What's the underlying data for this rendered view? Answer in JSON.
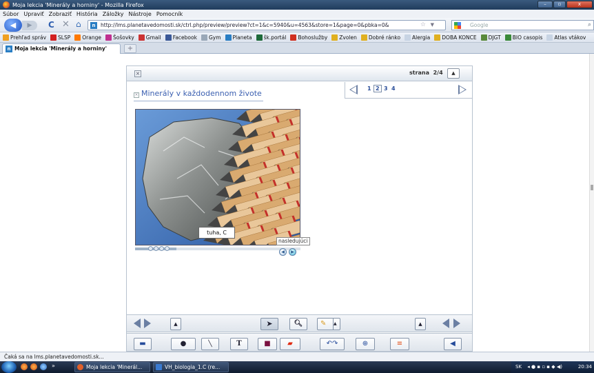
{
  "window": {
    "title": "Moja lekcia 'Minerály a horniny' - Mozilla Firefox",
    "controls": [
      "–",
      "▫",
      "x"
    ]
  },
  "menu": [
    "Súbor",
    "Upraviť",
    "Zobraziť",
    "História",
    "Záložky",
    "Nástroje",
    "Pomocník"
  ],
  "navbar": {
    "url": "http://lms.planetavedomosti.sk/ctrl.php/preview/preview?ct=1&c=5940&u=4563&store=1&page=0&pbka=0&",
    "search_placeholder": "Google"
  },
  "bookmarks": [
    {
      "label": "Prehľad správ",
      "color": "#f0a020"
    },
    {
      "label": "SLSP",
      "color": "#d22020"
    },
    {
      "label": "Orange",
      "color": "#ff7900"
    },
    {
      "label": "Šošovky",
      "color": "#c03090"
    },
    {
      "label": "Gmail",
      "color": "#c33"
    },
    {
      "label": "Facebook",
      "color": "#3b5998"
    },
    {
      "label": "Gym",
      "color": "#9aa8b8"
    },
    {
      "label": "Planeta",
      "color": "#2a7ec4"
    },
    {
      "label": "šk.portál",
      "color": "#1e6a3a"
    },
    {
      "label": "Bohoslužby",
      "color": "#d03020"
    },
    {
      "label": "Zvolen",
      "color": "#e0b020"
    },
    {
      "label": "Dobré ránko",
      "color": "#e0b020"
    },
    {
      "label": "Alergia",
      "color": "#c8d4e4"
    },
    {
      "label": "DOBA KONCE",
      "color": "#e0b020"
    },
    {
      "label": "DJGT",
      "color": "#5a8a3a"
    },
    {
      "label": "BIO casopis",
      "color": "#3a8a3a"
    },
    {
      "label": "Atlas vtákov",
      "color": "#c8d4e4"
    }
  ],
  "tabs": [
    {
      "label": "Moja lekcia 'Minerály a horniny'",
      "favicon": "n"
    }
  ],
  "newtab_label": "+",
  "player": {
    "page_label": "strana",
    "page_value": "2/4",
    "pages": [
      "1",
      "2",
      "3",
      "4"
    ],
    "current_page": "2",
    "lesson_title": "Minerály v každodennom živote",
    "caption": "tuha, C",
    "tooltip": "nasledujúci",
    "slide_progress": 0.25
  },
  "toolbar_text": {
    "text_tool": "T"
  },
  "status": "Čaká sa na lms.planetavedomosti.sk...",
  "taskbar": {
    "tasks": [
      {
        "label": "Moja lekcia 'Minerál...",
        "color": "#e0602a"
      },
      {
        "label": "VH_biologia_1.C (re...",
        "color": "#3a7ad0"
      }
    ],
    "lang": "SK",
    "clock": "20:34"
  },
  "colors": {
    "accent": "#3b5fb0",
    "titlebar": "#203c5c"
  }
}
